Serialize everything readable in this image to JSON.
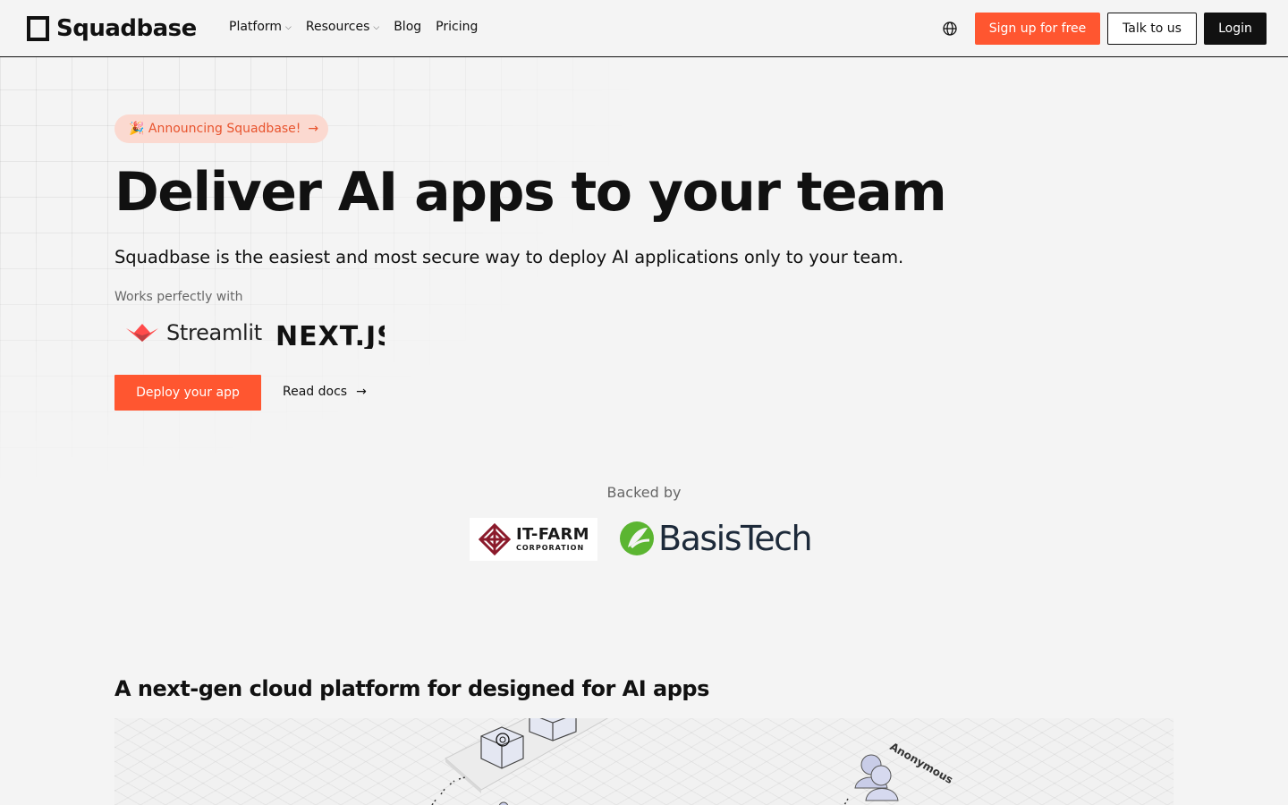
{
  "header": {
    "brand": "Squadbase",
    "nav": [
      {
        "label": "Platform",
        "has_dropdown": true
      },
      {
        "label": "Resources",
        "has_dropdown": true
      },
      {
        "label": "Blog",
        "has_dropdown": false
      },
      {
        "label": "Pricing",
        "has_dropdown": false
      }
    ],
    "language_icon": "globe-icon",
    "signup_label": "Sign up for free",
    "talk_label": "Talk to us",
    "login_label": "Login"
  },
  "hero": {
    "announcement": "🎉 Announcing Squadbase!",
    "title": "Deliver AI apps to your team",
    "subtitle": "Squadbase is the easiest and most secure way to deploy AI applications only to your team.",
    "works_with_label": "Works perfectly with",
    "integrations": [
      "Streamlit",
      "NEXT.JS"
    ],
    "deploy_label": "Deploy your app",
    "docs_label": "Read docs"
  },
  "backers": {
    "label": "Backed by",
    "logos": [
      {
        "name": "IT-FARM",
        "sub": "CORPORATION"
      },
      {
        "name": "BasisTech"
      }
    ]
  },
  "platform": {
    "title": "A next-gen cloud platform for designed for AI apps",
    "diagram_label": "Anonymous"
  },
  "colors": {
    "accent": "#ff5630",
    "announce_bg": "#fbd9d0",
    "page_bg": "#f4f4f4",
    "itfarm_red": "#8b1a2b",
    "basis_green": "#5bb531",
    "basis_navy": "#1d2a3a"
  }
}
